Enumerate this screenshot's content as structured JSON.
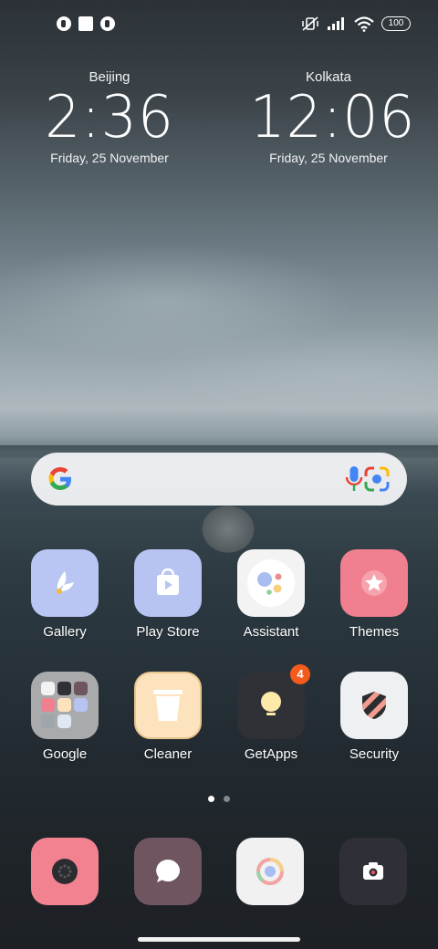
{
  "status_bar": {
    "battery": "100",
    "left_icons": [
      "notification-icon",
      "square-notification-icon",
      "notification-icon"
    ],
    "right_icons": [
      "mute-vibrate-icon",
      "signal-icon",
      "wifi-icon",
      "battery-icon"
    ]
  },
  "clocks": [
    {
      "city": "Beijing",
      "time": "2:36",
      "date": "Friday, 25 November"
    },
    {
      "city": "Kolkata",
      "time": "12:06",
      "date": "Friday, 25 November"
    }
  ],
  "search": {
    "icons": [
      "google-g-icon",
      "microphone-icon",
      "google-lens-icon"
    ]
  },
  "apps_row1": [
    {
      "label": "Gallery",
      "icon": "gallery-icon",
      "color": "#b9c6f3"
    },
    {
      "label": "Play Store",
      "icon": "play-store-icon",
      "color": "#b7c4f1"
    },
    {
      "label": "Assistant",
      "icon": "assistant-icon",
      "color": "#f3f3f3"
    },
    {
      "label": "Themes",
      "icon": "themes-icon",
      "color": "#f0808f"
    }
  ],
  "apps_row2": [
    {
      "label": "Google",
      "icon": "google-folder-icon",
      "color": "#a9aaab"
    },
    {
      "label": "Cleaner",
      "icon": "cleaner-icon",
      "color": "#fde3bd"
    },
    {
      "label": "GetApps",
      "icon": "getapps-icon",
      "color": "#2f3136",
      "badge": "4"
    },
    {
      "label": "Security",
      "icon": "security-icon",
      "color": "#eef0f2"
    }
  ],
  "dock": [
    {
      "icon": "phone-icon",
      "color": "#f2828f"
    },
    {
      "icon": "messages-icon",
      "color": "#6e5560"
    },
    {
      "icon": "chrome-icon",
      "color": "#f1f1f1"
    },
    {
      "icon": "camera-icon",
      "color": "#2f3037"
    }
  ],
  "pagination": {
    "pages": 2,
    "active": 1
  }
}
